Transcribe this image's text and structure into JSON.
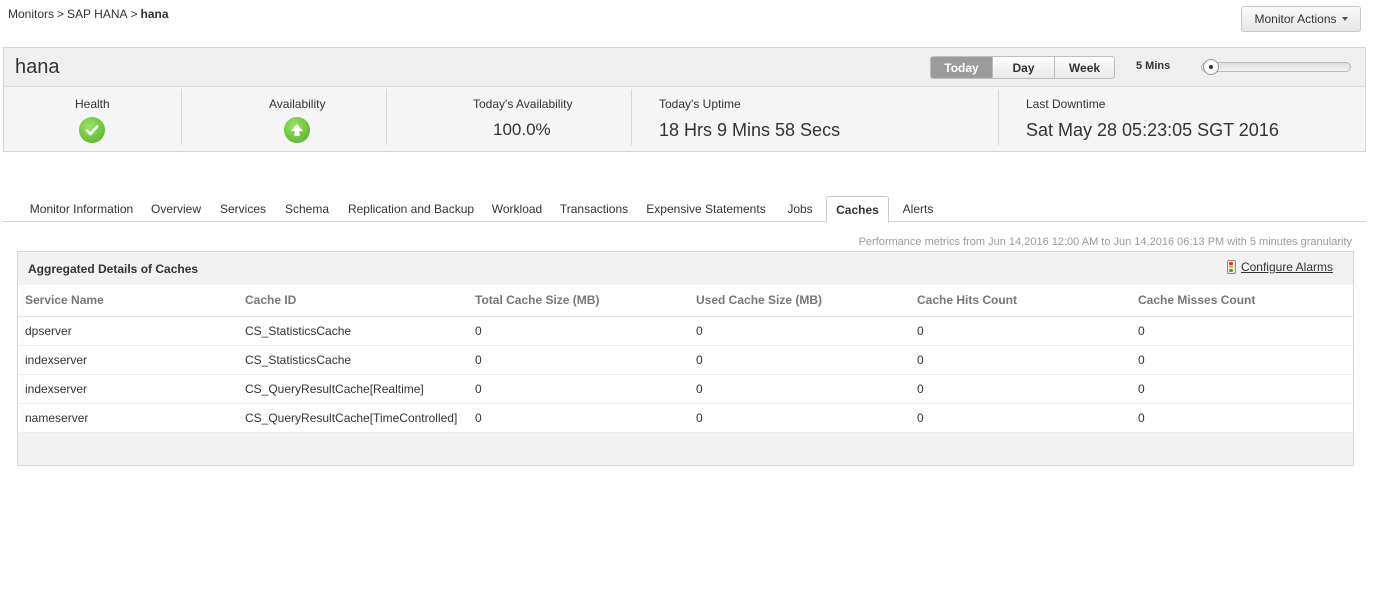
{
  "breadcrumb": {
    "root": "Monitors",
    "parent": "SAP HANA",
    "current": "hana",
    "separator": ">"
  },
  "monitor_actions": {
    "label": "Monitor Actions"
  },
  "header": {
    "monitor_name": "hana",
    "range_buttons": [
      "Today",
      "Day",
      "Week"
    ],
    "active_range": "Today",
    "granularity_label": "5 Mins"
  },
  "stats": {
    "health": {
      "label": "Health",
      "icon": "check-icon",
      "color": "#5cbf2a"
    },
    "availability": {
      "label": "Availability",
      "icon": "arrow-up-icon",
      "color": "#5cbf2a"
    },
    "todays_availability": {
      "label": "Today's Availability",
      "value": "100.0%"
    },
    "todays_uptime": {
      "label": "Today's Uptime",
      "value": "18 Hrs 9 Mins 58 Secs"
    },
    "last_downtime": {
      "label": "Last Downtime",
      "value": "Sat May 28 05:23:05 SGT 2016"
    }
  },
  "tabs": [
    "Monitor Information",
    "Overview",
    "Services",
    "Schema",
    "Replication and Backup",
    "Workload",
    "Transactions",
    "Expensive Statements",
    "Jobs",
    "Caches",
    "Alerts"
  ],
  "active_tab": "Caches",
  "perf_note": "Performance metrics from Jun 14,2016 12:00 AM to Jun 14,2016 06:13 PM with 5 minutes granularity",
  "panel": {
    "title": "Aggregated Details of Caches",
    "configure_alarms": "Configure Alarms",
    "columns": [
      "Service Name",
      "Cache ID",
      "Total Cache Size  (MB)",
      "Used Cache Size  (MB)",
      "Cache Hits Count",
      "Cache Misses Count"
    ],
    "rows": [
      [
        "dpserver",
        "CS_StatisticsCache",
        "0",
        "0",
        "0",
        "0"
      ],
      [
        "indexserver",
        "CS_StatisticsCache",
        "0",
        "0",
        "0",
        "0"
      ],
      [
        "indexserver",
        "CS_QueryResultCache[Realtime]",
        "0",
        "0",
        "0",
        "0"
      ],
      [
        "nameserver",
        "CS_QueryResultCache[TimeControlled]",
        "0",
        "0",
        "0",
        "0"
      ]
    ]
  }
}
